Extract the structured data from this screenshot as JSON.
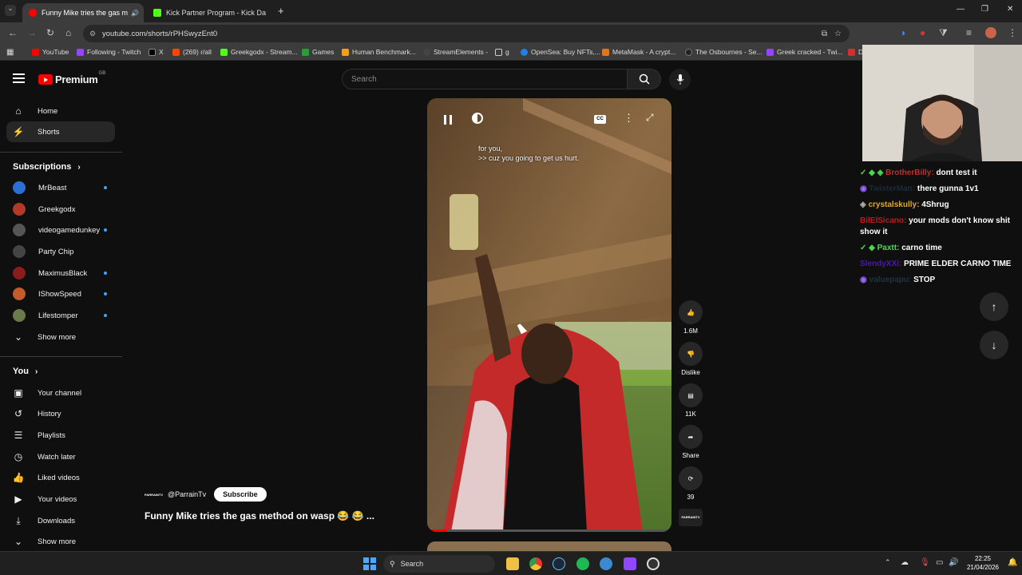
{
  "browser": {
    "tabs": [
      {
        "title": "Funny Mike tries the gas m",
        "color": "#ff0000"
      },
      {
        "title": "Kick Partner Program - Kick Da",
        "color": "#53fc18"
      }
    ],
    "url": "youtube.com/shorts/rPHSwyzEnt0",
    "bookmarks": [
      "YouTube",
      "Following - Twitch",
      "X",
      "(269) r/all",
      "Greekgodx - Stream...",
      "Games",
      "Human Benchmark...",
      "StreamElements -",
      "g",
      "OpenSea: Buy NFTs,...",
      "MetaMask - A crypt...",
      "The Osbournes - Se...",
      "Greek cracked - Twi...",
      "D"
    ]
  },
  "youtube": {
    "logo_text": "Premium",
    "logo_sup": "GB",
    "search_placeholder": "Search",
    "nav": [
      {
        "label": "Home",
        "icon": "home-icon"
      },
      {
        "label": "Shorts",
        "icon": "shorts-icon"
      }
    ],
    "subscriptions_title": "Subscriptions",
    "subscriptions": [
      {
        "label": "MrBeast",
        "color": "#2b6fd6",
        "dot": true
      },
      {
        "label": "Greekgodx",
        "color": "#b33a2a",
        "dot": false
      },
      {
        "label": "videogamedunkey",
        "color": "#555",
        "dot": true
      },
      {
        "label": "Party Chip",
        "color": "#444",
        "dot": false
      },
      {
        "label": "MaximusBlack",
        "color": "#8a1c1c",
        "dot": true
      },
      {
        "label": "IShowSpeed",
        "color": "#c55a2a",
        "dot": true
      },
      {
        "label": "Lifestomper",
        "color": "#6a7a4a",
        "dot": true
      }
    ],
    "show_more": "Show more",
    "you_title": "You",
    "you_items": [
      {
        "label": "Your channel",
        "icon": "person-icon"
      },
      {
        "label": "History",
        "icon": "history-icon"
      },
      {
        "label": "Playlists",
        "icon": "playlist-icon"
      },
      {
        "label": "Watch later",
        "icon": "clock-icon"
      },
      {
        "label": "Liked videos",
        "icon": "thumbs-up-icon"
      },
      {
        "label": "Your videos",
        "icon": "video-icon"
      },
      {
        "label": "Downloads",
        "icon": "download-icon"
      }
    ],
    "show_more_2": "Show more",
    "short": {
      "caption_line1": "for you,",
      "caption_line2": ">> cuz you going to get us hurt.",
      "channel": "@ParrainTv",
      "channel_badge": "PARRAINTV",
      "subscribe": "Subscribe",
      "title": "Funny Mike tries the gas method on wasp 😂 😂 ...",
      "likes": "1.6M",
      "dislike": "Dislike",
      "comments": "11K",
      "share": "Share",
      "remix": "39",
      "sound_label": "PARRAINTV"
    }
  },
  "chat": [
    {
      "user": "BrotherBilly:",
      "user_color": "#b5322e",
      "msg": "dont test it"
    },
    {
      "user": "TwisterMan:",
      "user_color": "#1a2a3a",
      "msg": "there gunna 1v1"
    },
    {
      "user": "crystalskully:",
      "user_color": "#d8a92f",
      "msg": "4Shrug"
    },
    {
      "user": "BilElSicano:",
      "user_color": "#c01818",
      "msg": "your mods don't know shit show it"
    },
    {
      "user": "Paxtt:",
      "user_color": "#4fd64f",
      "msg": "carno time"
    },
    {
      "user": "SlendyXXi:",
      "user_color": "#4a1aa8",
      "msg": "PRIME ELDER CARNO TIME"
    },
    {
      "user": "valuepapu:",
      "user_color": "#1c3540",
      "msg": "STOP"
    }
  ],
  "taskbar": {
    "search": "Search",
    "time": "22:25",
    "date": "21/04/2026"
  }
}
